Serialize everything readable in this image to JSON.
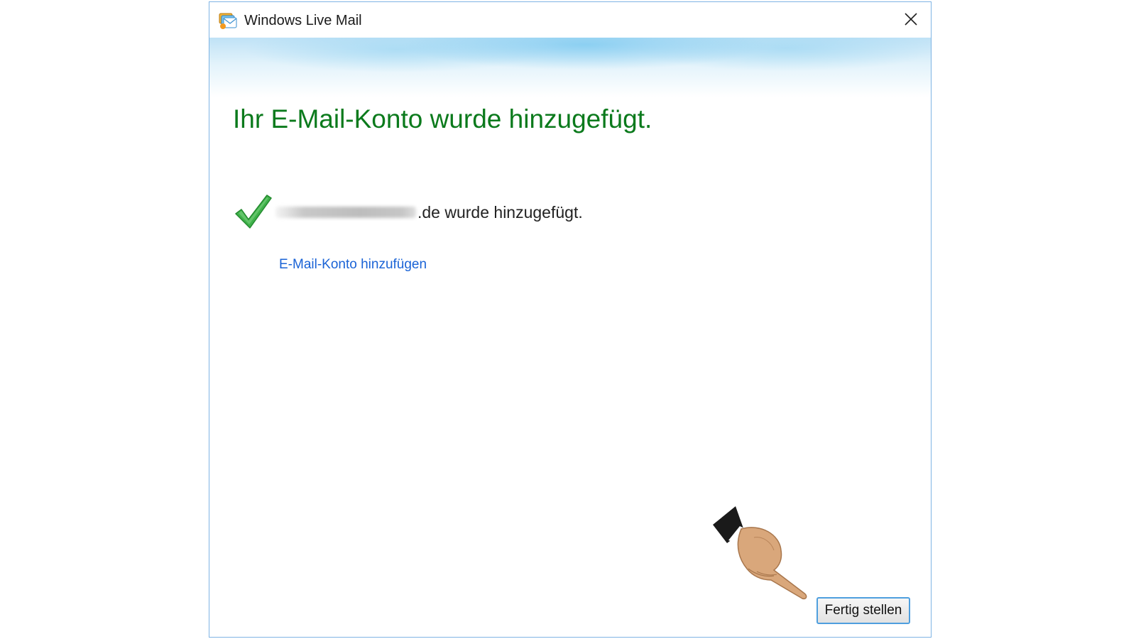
{
  "window": {
    "title": "Windows Live Mail",
    "app_icon": "windows-live-mail-icon",
    "close_icon": "close-icon"
  },
  "content": {
    "heading": "Ihr E-Mail-Konto wurde hinzugefügt.",
    "status_icon": "green-check-icon",
    "status_text": ".de wurde hinzugefügt.",
    "add_account_link": "E-Mail-Konto hinzufügen"
  },
  "footer": {
    "finish_button": "Fertig stellen"
  },
  "overlay": {
    "pointer_icon": "pointing-hand-icon"
  },
  "colors": {
    "heading": "#0b7a1c",
    "link": "#1a63d6",
    "window_border": "#7fb4e4",
    "button_border": "#4f9fde"
  }
}
